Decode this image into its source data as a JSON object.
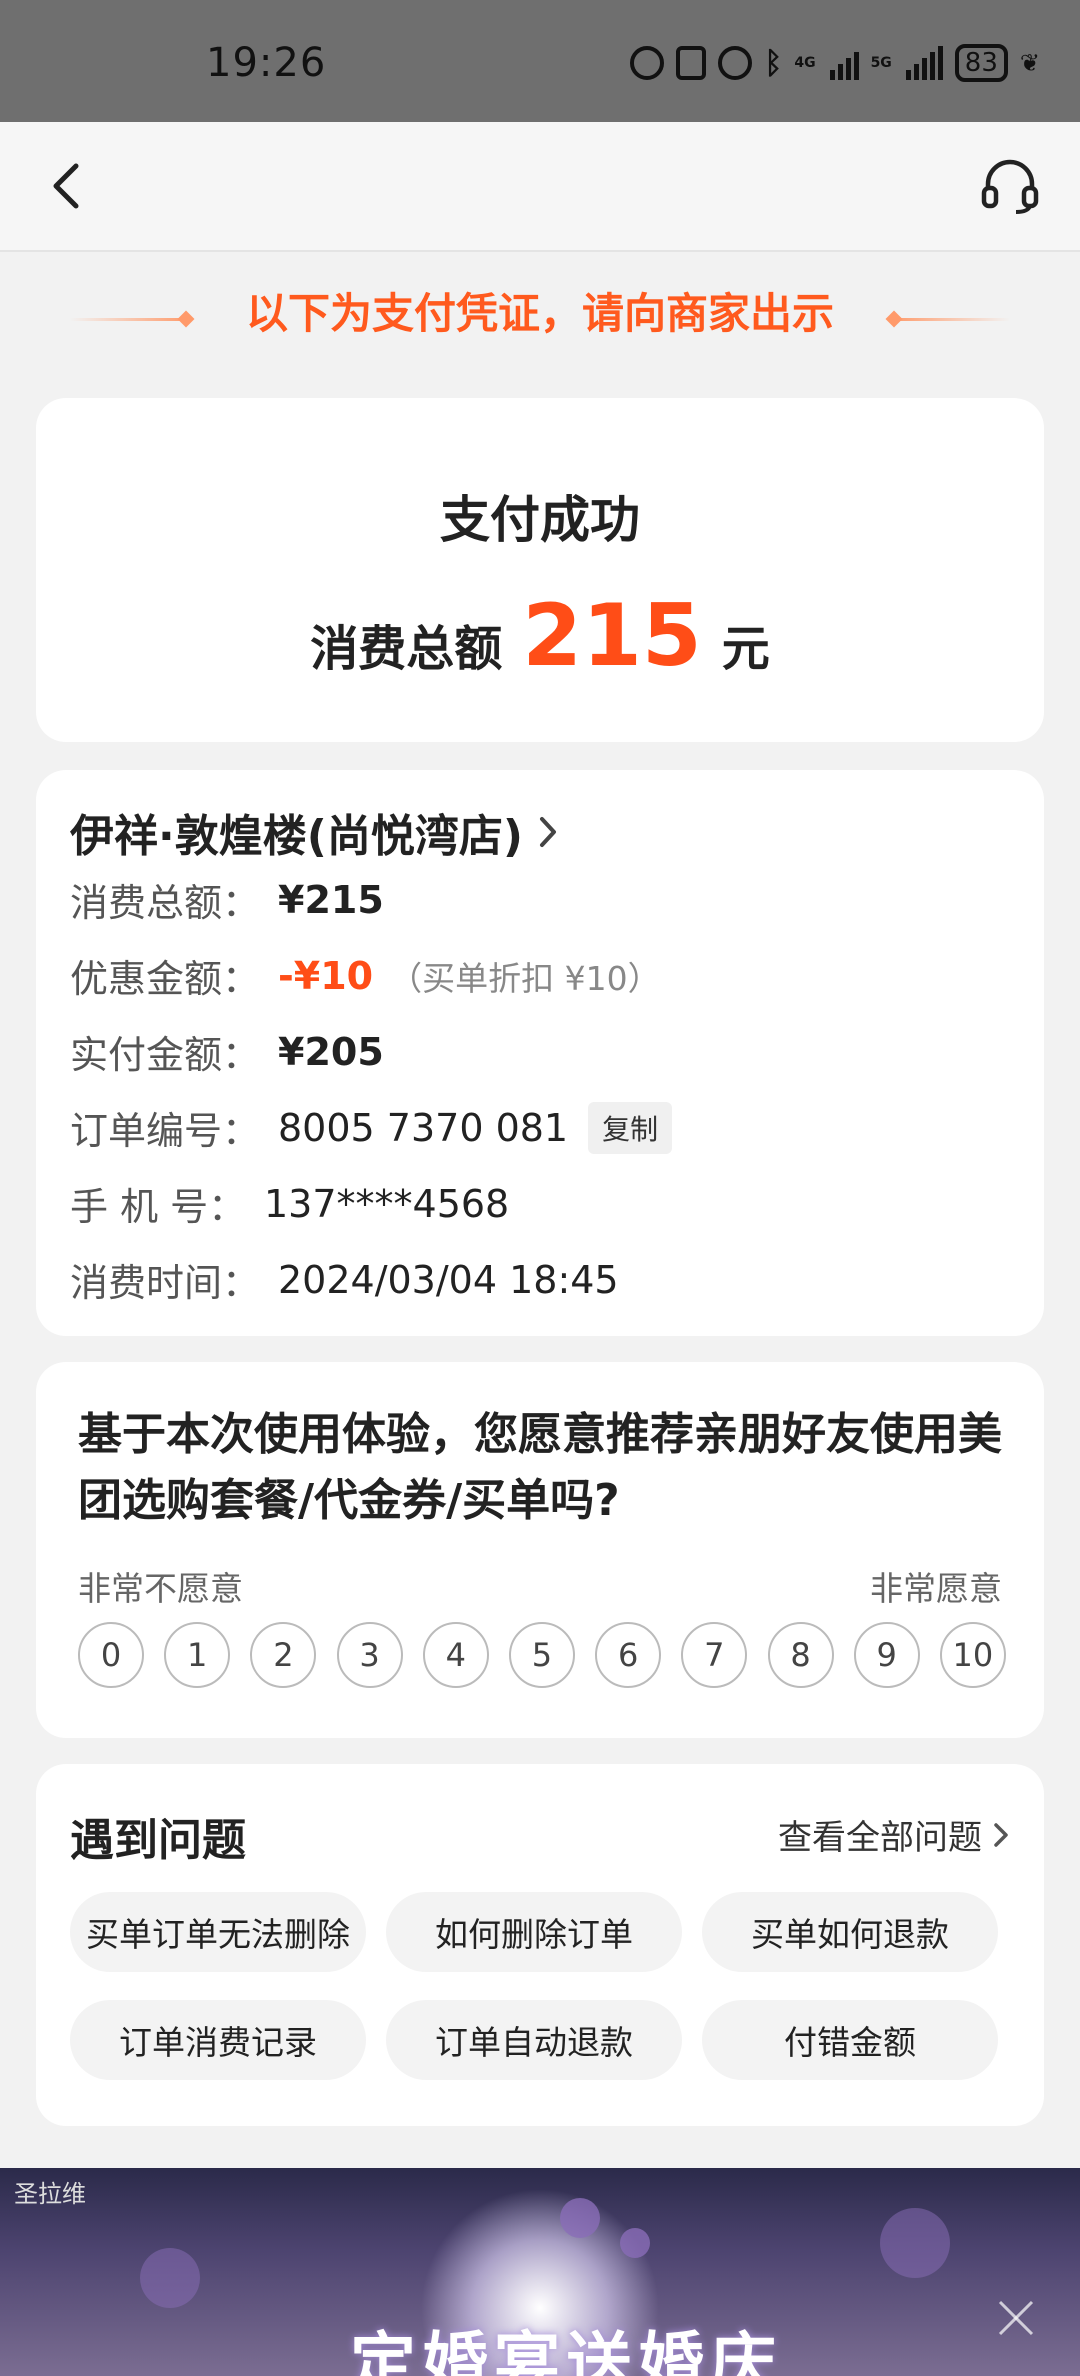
{
  "status_bar": {
    "time": "19:26",
    "battery": "83",
    "network_labels": [
      "4G",
      "5G"
    ]
  },
  "nav": {
    "back_icon": "chevron-left-icon",
    "support_icon": "headset-icon"
  },
  "banner": {
    "text": "以下为支付凭证，请向商家出示",
    "color": "#ff5a1e"
  },
  "payment": {
    "status": "支付成功",
    "total_label": "消费总额",
    "total_amount": "215",
    "unit": "元",
    "accent_color": "#ff4d17"
  },
  "order": {
    "store_name": "伊祥·敦煌楼(尚悦湾店)",
    "rows": [
      {
        "key": "消费总额：",
        "value": "¥215"
      },
      {
        "key": "优惠金额：",
        "value": "-¥10",
        "note": "（买单折扣 ¥10）"
      },
      {
        "key": "实付金额：",
        "value": "¥205"
      },
      {
        "key": "订单编号：",
        "value": "8005 7370 081",
        "action": "复制"
      },
      {
        "key": "手 机 号：",
        "value": "137****4568"
      },
      {
        "key": "消费时间：",
        "value": "2024/03/04 18:45"
      }
    ]
  },
  "survey": {
    "question": "基于本次使用体验，您愿意推荐亲朋好友使用美团选购套餐/代金券/买单吗?",
    "low_label": "非常不愿意",
    "high_label": "非常愿意",
    "scale": [
      "0",
      "1",
      "2",
      "3",
      "4",
      "5",
      "6",
      "7",
      "8",
      "9",
      "10"
    ]
  },
  "help": {
    "title": "遇到问题",
    "view_all": "查看全部问题",
    "topics": [
      "买单订单无法删除",
      "如何删除订单",
      "买单如何退款",
      "订单消费记录",
      "订单自动退款",
      "付错金额"
    ]
  },
  "ad": {
    "text": "定婚宴送婚庆",
    "brand": "圣拉维"
  }
}
